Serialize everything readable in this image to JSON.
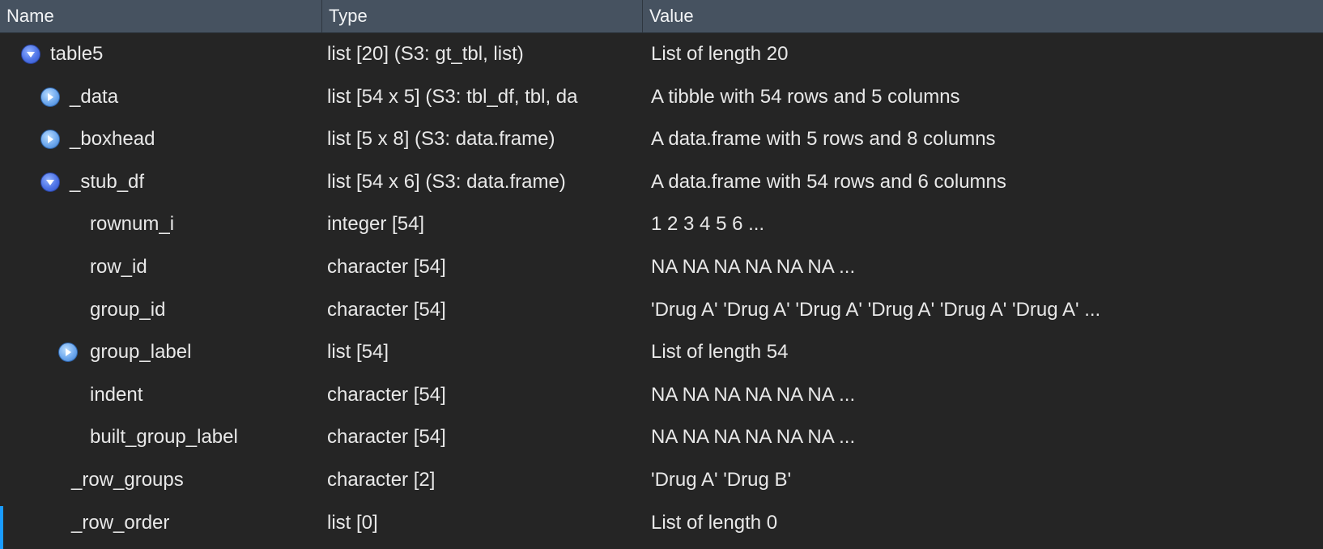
{
  "header": {
    "name": "Name",
    "type": "Type",
    "value": "Value"
  },
  "rows": [
    {
      "name": "table5",
      "type": "list [20] (S3: gt_tbl, list)",
      "value": "List of length 20",
      "toggle": "expanded"
    },
    {
      "name": "_data",
      "type": "list [54 x 5] (S3: tbl_df, tbl, da",
      "value": "A tibble with 54 rows and 5 columns",
      "toggle": "collapsed"
    },
    {
      "name": "_boxhead",
      "type": "list [5 x 8] (S3: data.frame)",
      "value": "A data.frame with 5 rows and 8 columns",
      "toggle": "collapsed"
    },
    {
      "name": "_stub_df",
      "type": "list [54 x 6] (S3: data.frame)",
      "value": "A data.frame with 54 rows and 6 columns",
      "toggle": "expanded"
    },
    {
      "name": "rownum_i",
      "type": "integer [54]",
      "value": "1 2 3 4 5 6 ...",
      "toggle": "none"
    },
    {
      "name": "row_id",
      "type": "character [54]",
      "value": "NA NA NA NA NA NA ...",
      "toggle": "none"
    },
    {
      "name": "group_id",
      "type": "character [54]",
      "value": "'Drug A' 'Drug A' 'Drug A' 'Drug A' 'Drug A' 'Drug A' ...",
      "toggle": "none"
    },
    {
      "name": "group_label",
      "type": "list [54]",
      "value": "List of length 54",
      "toggle": "collapsed"
    },
    {
      "name": "indent",
      "type": "character [54]",
      "value": "NA NA NA NA NA NA ...",
      "toggle": "none"
    },
    {
      "name": "built_group_label",
      "type": "character [54]",
      "value": "NA NA NA NA NA NA ...",
      "toggle": "none"
    },
    {
      "name": "_row_groups",
      "type": "character [2]",
      "value": "'Drug A' 'Drug B'",
      "toggle": "none"
    },
    {
      "name": "_row_order",
      "type": "list [0]",
      "value": "List of length 0",
      "toggle": "none"
    }
  ],
  "colors": {
    "header_bg": "#465260",
    "body_bg": "#252525",
    "focus_bar": "#1a9cff",
    "expanded_icon": "#4f74e6",
    "collapsed_icon": "#6fa9ee"
  },
  "icons": {
    "expanded": "triangle-down-icon",
    "collapsed": "triangle-right-icon"
  }
}
